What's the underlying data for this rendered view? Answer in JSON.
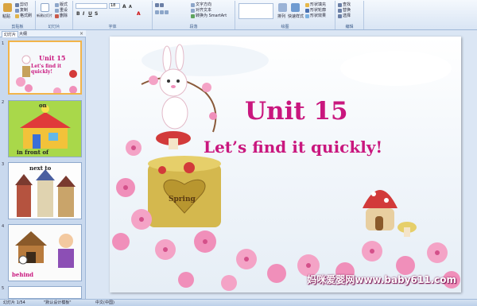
{
  "ribbon": {
    "groups": [
      {
        "id": "clipboard",
        "label": "剪贴板"
      },
      {
        "id": "slides",
        "label": "幻灯片"
      },
      {
        "id": "font",
        "label": "字体"
      },
      {
        "id": "paragraph",
        "label": "段落"
      },
      {
        "id": "drawing",
        "label": "绘图"
      },
      {
        "id": "editing",
        "label": "编辑"
      }
    ],
    "paste": "粘贴",
    "cut": "剪切",
    "copy": "复制",
    "format_painter": "格式刷",
    "new_slide": "新建幻灯片",
    "layout": "版式",
    "reset": "重设",
    "delete": "删除",
    "font_size": "18",
    "text_direction": "文字方向",
    "align_text": "对齐文本",
    "smartart": "转换为 SmartArt",
    "arrange": "排列",
    "quick_styles": "快速样式",
    "shape_fill": "形状填充",
    "shape_outline": "形状轮廓",
    "shape_effects": "形状效果",
    "find": "查找",
    "replace": "替换",
    "select": "选择"
  },
  "panel": {
    "tabs": [
      "幻灯片",
      "大纲"
    ],
    "close": "×",
    "thumbs": [
      {
        "num": "1",
        "line1": "Unit 15",
        "line2": "Let's find it quickly!"
      },
      {
        "num": "2",
        "top": "on",
        "bottom": "in front of"
      },
      {
        "num": "3",
        "top": "next to"
      },
      {
        "num": "4",
        "bottom": "behind"
      },
      {
        "num": "5"
      }
    ]
  },
  "slide": {
    "title": "Unit 15",
    "subtitle": "Let’s find it quickly!",
    "stump_text": "Spring",
    "watermark": "妈咪爱婴网www.baby611.com"
  },
  "status": {
    "slide_count": "幻灯片 1/54",
    "theme": "\"默认设计模板\"",
    "language": "中文(中国)"
  },
  "colors": {
    "title": "#c9177e",
    "ribbon": "#dbe6f4",
    "selected_thumb": "#f2b44a"
  }
}
